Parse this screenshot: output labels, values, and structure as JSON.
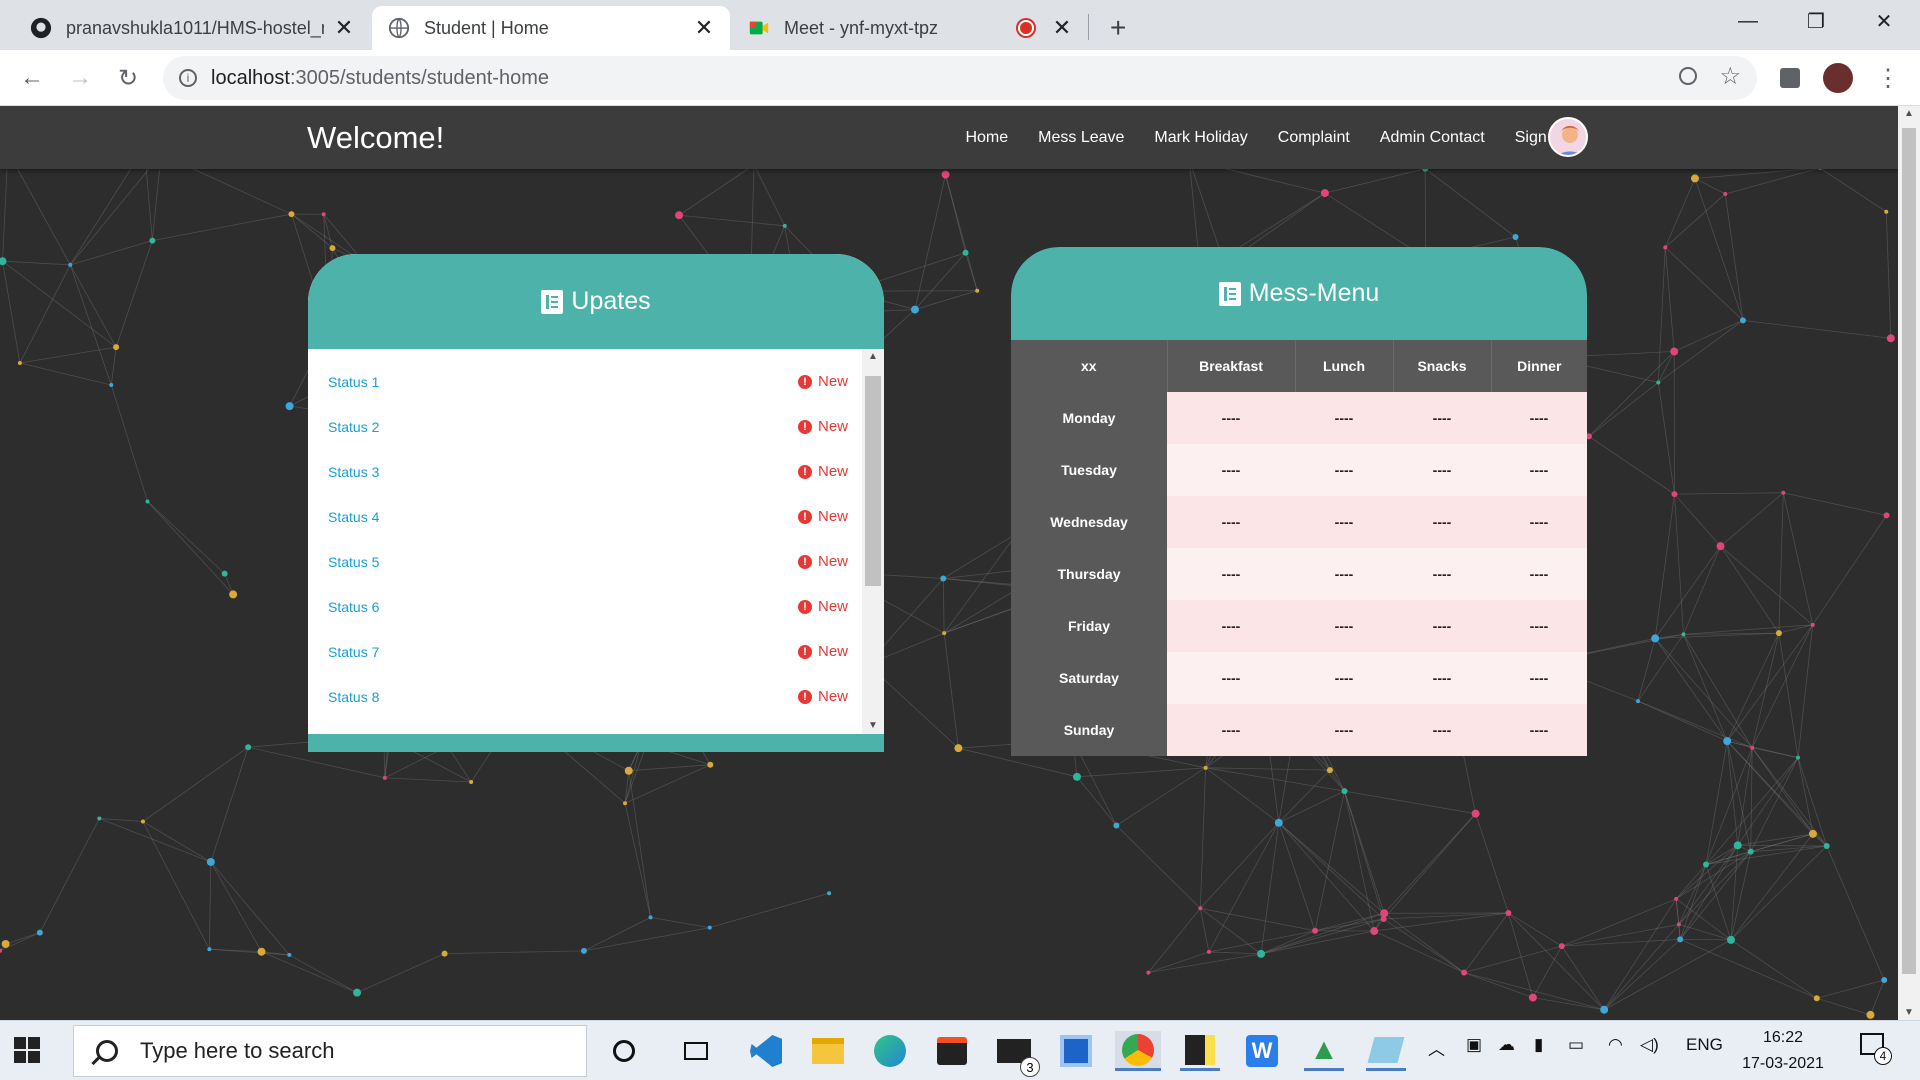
{
  "browser": {
    "tabs": [
      {
        "title": "pranavshukla1011/HMS-hostel_m",
        "icon": "github-icon"
      },
      {
        "title": "Student | Home",
        "icon": "globe-icon"
      },
      {
        "title": "Meet - ynf-myxt-tpz",
        "icon": "meet-icon"
      }
    ],
    "url_host": "localhost",
    "url_path": ":3005/students/student-home"
  },
  "navbar": {
    "brand": "Welcome!",
    "links": [
      "Home",
      "Mess Leave",
      "Mark Holiday",
      "Complaint",
      "Admin Contact",
      "Sign Out"
    ]
  },
  "updates": {
    "title": "Upates",
    "items": [
      {
        "label": "Status 1",
        "badge": "New"
      },
      {
        "label": "Status 2",
        "badge": "New"
      },
      {
        "label": "Status 3",
        "badge": "New"
      },
      {
        "label": "Status 4",
        "badge": "New"
      },
      {
        "label": "Status 5",
        "badge": "New"
      },
      {
        "label": "Status 6",
        "badge": "New"
      },
      {
        "label": "Status 7",
        "badge": "New"
      },
      {
        "label": "Status 8",
        "badge": "New"
      }
    ]
  },
  "mess_menu": {
    "title": "Mess-Menu",
    "headers": [
      "xx",
      "Breakfast",
      "Lunch",
      "Snacks",
      "Dinner"
    ],
    "rows": [
      {
        "day": "Monday",
        "meals": [
          "----",
          "----",
          "----",
          "----"
        ]
      },
      {
        "day": "Tuesday",
        "meals": [
          "----",
          "----",
          "----",
          "----"
        ]
      },
      {
        "day": "Wednesday",
        "meals": [
          "----",
          "----",
          "----",
          "----"
        ]
      },
      {
        "day": "Thursday",
        "meals": [
          "----",
          "----",
          "----",
          "----"
        ]
      },
      {
        "day": "Friday",
        "meals": [
          "----",
          "----",
          "----",
          "----"
        ]
      },
      {
        "day": "Saturday",
        "meals": [
          "----",
          "----",
          "----",
          "----"
        ]
      },
      {
        "day": "Sunday",
        "meals": [
          "----",
          "----",
          "----",
          "----"
        ]
      }
    ]
  },
  "taskbar": {
    "search_placeholder": "Type here to search",
    "language": "ENG",
    "time": "16:22",
    "date": "17-03-2021",
    "notification_count": "4",
    "mail_badge": "3"
  }
}
